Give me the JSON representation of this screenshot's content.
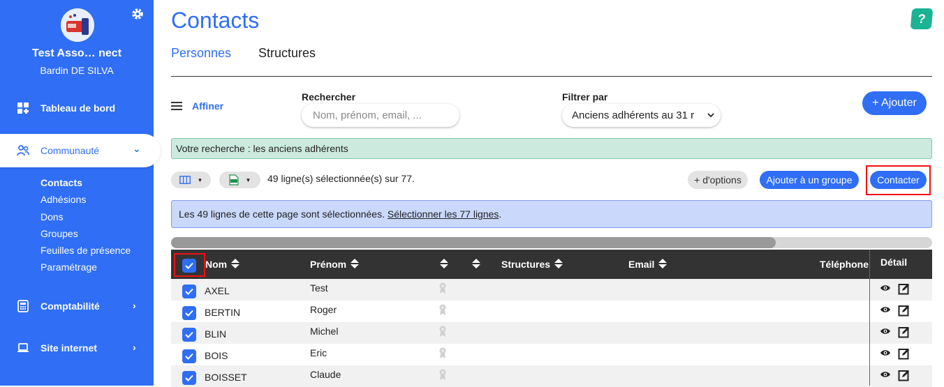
{
  "sidebar": {
    "org_name": "Test Asso… nect",
    "user_name": "Bardin DE SILVA",
    "items": [
      {
        "label": "Tableau de bord",
        "icon": "dashboard-icon"
      },
      {
        "label": "Communauté",
        "icon": "people-icon",
        "chevron": "⌄"
      },
      {
        "label": "Comptabilité",
        "icon": "calculator-icon",
        "chevron": "›"
      },
      {
        "label": "Site internet",
        "icon": "laptop-icon",
        "chevron": "›"
      }
    ],
    "submenu": [
      "Contacts",
      "Adhésions",
      "Dons",
      "Groupes",
      "Feuilles de présence",
      "Paramétrage"
    ]
  },
  "header": {
    "title": "Contacts",
    "help_label": "?",
    "tabs": [
      "Personnes",
      "Structures"
    ]
  },
  "toolbar": {
    "affiner_label": "Affiner",
    "search_label": "Rechercher",
    "search_placeholder": "Nom, prénom, email, ...",
    "filter_label": "Filtrer par",
    "filter_value": "Anciens adhérents au 31 r",
    "add_label": "+ Ajouter"
  },
  "notice_search": "Votre recherche : les anciens adhérents",
  "actions": {
    "selection_text": "49 ligne(s) sélectionnée(s) sur 77.",
    "options_label": "+ d'options",
    "group_label": "Ajouter à un groupe",
    "contact_label": "Contacter"
  },
  "notice_selection": {
    "text": "Les 49 lignes de cette page sont sélectionnées.",
    "link": "Sélectionner les 77 lignes",
    "suffix": "."
  },
  "table": {
    "columns": {
      "nom": "Nom",
      "prenom": "Prénom",
      "structures": "Structures",
      "email": "Email",
      "telephone": "Téléphone f",
      "detail": "Détail"
    },
    "rows": [
      {
        "nom": "AXEL",
        "prenom": "Test"
      },
      {
        "nom": "BERTIN",
        "prenom": "Roger"
      },
      {
        "nom": "BLIN",
        "prenom": "Michel"
      },
      {
        "nom": "BOIS",
        "prenom": "Eric"
      },
      {
        "nom": "BOISSET",
        "prenom": "Claude"
      }
    ]
  },
  "colors": {
    "accent": "#2f6ef5",
    "help": "#1ab394",
    "highlight": "#ee1111"
  }
}
